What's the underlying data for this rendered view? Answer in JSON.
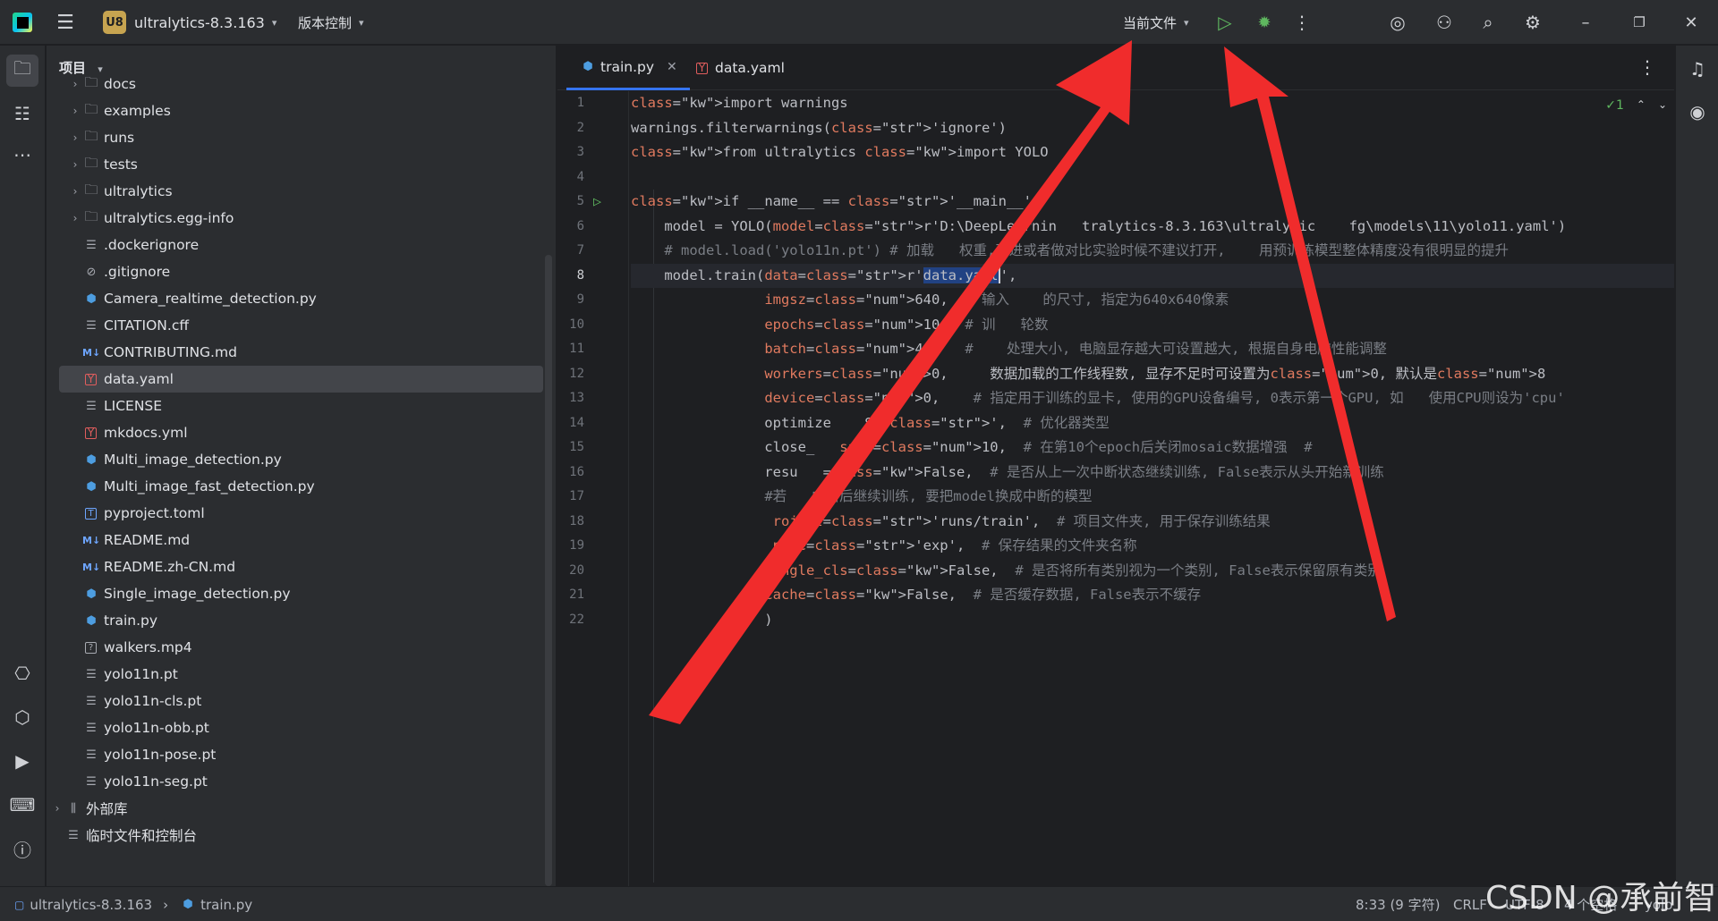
{
  "titlebar": {
    "project_badge": "U8",
    "project_name": "ultralytics-8.3.163",
    "vcs_label": "版本控制",
    "run_config": "当前文件"
  },
  "project_panel": {
    "title": "项目",
    "items": [
      {
        "label": "docs",
        "type": "folder",
        "arrow": true
      },
      {
        "label": "examples",
        "type": "folder",
        "arrow": true
      },
      {
        "label": "runs",
        "type": "folder",
        "arrow": true
      },
      {
        "label": "tests",
        "type": "folder-pkg",
        "arrow": true
      },
      {
        "label": "ultralytics",
        "type": "folder-pkg",
        "arrow": true
      },
      {
        "label": "ultralytics.egg-info",
        "type": "folder",
        "arrow": true
      },
      {
        "label": ".dockerignore",
        "type": "text"
      },
      {
        "label": ".gitignore",
        "type": "ignore"
      },
      {
        "label": "Camera_realtime_detection.py",
        "type": "py"
      },
      {
        "label": "CITATION.cff",
        "type": "text"
      },
      {
        "label": "CONTRIBUTING.md",
        "type": "md"
      },
      {
        "label": "data.yaml",
        "type": "yaml",
        "selected": true
      },
      {
        "label": "LICENSE",
        "type": "text"
      },
      {
        "label": "mkdocs.yml",
        "type": "yaml"
      },
      {
        "label": "Multi_image_detection.py",
        "type": "py"
      },
      {
        "label": "Multi_image_fast_detection.py",
        "type": "py"
      },
      {
        "label": "pyproject.toml",
        "type": "toml"
      },
      {
        "label": "README.md",
        "type": "md"
      },
      {
        "label": "README.zh-CN.md",
        "type": "md"
      },
      {
        "label": "Single_image_detection.py",
        "type": "py"
      },
      {
        "label": "train.py",
        "type": "py"
      },
      {
        "label": "walkers.mp4",
        "type": "unk"
      },
      {
        "label": "yolo11n.pt",
        "type": "text"
      },
      {
        "label": "yolo11n-cls.pt",
        "type": "text"
      },
      {
        "label": "yolo11n-obb.pt",
        "type": "text"
      },
      {
        "label": "yolo11n-pose.pt",
        "type": "text"
      },
      {
        "label": "yolo11n-seg.pt",
        "type": "text"
      },
      {
        "label": "外部库",
        "type": "lib",
        "arrow": true,
        "root": true
      },
      {
        "label": "临时文件和控制台",
        "type": "scratch",
        "root": true
      }
    ]
  },
  "tabs": [
    {
      "label": "train.py",
      "icon": "python-file-icon",
      "active": true
    },
    {
      "label": "data.yaml",
      "icon": "yaml-file-icon",
      "active": false
    }
  ],
  "editor": {
    "inspection_count": "1",
    "current_line": 8,
    "lines": [
      "import warnings",
      "warnings.filterwarnings('ignore')",
      "from ultralytics import YOLO",
      "",
      "if __name__ == '__main__':",
      "    model = YOLO(model=r'D:\\DeepLearnin   tralytics-8.3.163\\ultralytic    fg\\models\\11\\yolo11.yaml')",
      "    # model.load('yolo11n.pt') # 加载   权重,改进或者做对比实验时候不建议打开,    用预训练模型整体精度没有很明显的提升",
      "    model.train(data=r'data.yaml',",
      "                imgsz=640,  # 输入    的尺寸, 指定为640x640像素",
      "                epochs=10,  # 训   轮数",
      "                batch=4,    #    处理大小, 电脑显存越大可设置越大, 根据自身电脑性能调整",
      "                workers=0,     数据加载的工作线程数, 显存不足时可设置为0, 默认是8",
      "                device=0,    # 指定用于训练的显卡, 使用的GPU设备编号, 0表示第一个GPU, 如   使用CPU则设为'cpu'",
      "                optimize    SGD',  # 优化器类型",
      "                close_   saic=10,  # 在第10个epoch后关闭mosaic数据增强  #",
      "                resu   =False,  # 是否从上一次中断状态继续训练, False表示从头开始新训练",
      "                #若   中断后继续训练, 要把model换成中断的模型",
      "                 roject='runs/train',  # 项目文件夹, 用于保存训练结果",
      "                 name='exp',  # 保存结果的文件夹名称",
      "                single_cls=False,  # 是否将所有类别视为一个类别, False表示保留原有类别",
      "                cache=False,  # 是否缓存数据, False表示不缓存",
      "                )"
    ]
  },
  "statusbar": {
    "breadcrumb_project": "ultralytics-8.3.163",
    "breadcrumb_file": "train.py",
    "position": "8:33 (9 字符)",
    "line_sep": "CRLF",
    "encoding": "UTF-8",
    "indent": "4 个空格",
    "interpreter": "yolo"
  },
  "watermark": "CSDN @承前智",
  "colors": {
    "accent": "#3574f0",
    "arrow": "#f02c2c",
    "run_green": "#5fb85f"
  }
}
